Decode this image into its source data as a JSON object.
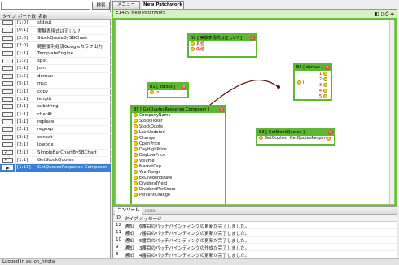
{
  "search": {
    "placeholder": "",
    "button_label": "検索"
  },
  "tabs": [
    {
      "label": "メニュー"
    },
    {
      "label": "New Patchwork"
    }
  ],
  "list": {
    "headers": [
      "タイプ",
      "ポート数",
      "名前"
    ],
    "rows": [
      {
        "ports": "[1:0]",
        "name": "stdout",
        "type": "normal"
      },
      {
        "ports": "[0:1]",
        "name": "実験表現式は正しい?",
        "type": "normal"
      },
      {
        "ports": "[2:0]",
        "name": "StockQuoteBySBChart",
        "type": "normal"
      },
      {
        "ports": "[2:0]",
        "name": "範囲便利経済Googleカラフ出力",
        "type": "normal"
      },
      {
        "ports": "[1:1]",
        "name": "TemplateEngine",
        "type": "normal"
      },
      {
        "ports": "[1:2]",
        "name": "split",
        "type": "normal"
      },
      {
        "ports": "[2:1]",
        "name": "join",
        "type": "normal"
      },
      {
        "ports": "[1:5]",
        "name": "demux",
        "type": "normal"
      },
      {
        "ports": "[5:1]",
        "name": "mux",
        "type": "normal"
      },
      {
        "ports": "[1:1]",
        "name": "copy",
        "type": "normal"
      },
      {
        "ports": "[1:1]",
        "name": "length",
        "type": "normal"
      },
      {
        "ports": "[3:1]",
        "name": "substring",
        "type": "normal"
      },
      {
        "ports": "[1:1]",
        "name": "charAt",
        "type": "normal"
      },
      {
        "ports": "[3:1]",
        "name": "replace",
        "type": "normal"
      },
      {
        "ports": "[2:1]",
        "name": "regexp",
        "type": "normal"
      },
      {
        "ports": "[2:1]",
        "name": "concat",
        "type": "normal"
      },
      {
        "ports": "[2:1]",
        "name": "lowbdx",
        "type": "normal"
      },
      {
        "ports": "[2:1]",
        "name": "SimpleBarChartBySBChart",
        "type": "check"
      },
      {
        "ports": "[1:1]",
        "name": "GetStockQuotes",
        "type": "check"
      },
      {
        "ports": "[1:13]",
        "name": "GetQuotesResponse Composer",
        "type": "run"
      }
    ]
  },
  "editor": {
    "title": "E1429 New Patchwork",
    "tools": "◧ ▯ ⎙ ◈"
  },
  "nodes": {
    "b2": {
      "title": "B2 [ 実験表現式は正しい? ]",
      "ports": [
        "真値",
        "偽値"
      ]
    },
    "b1": {
      "title": "B1 [ stdout ]",
      "ports": [
        "in"
      ]
    },
    "b4": {
      "title": "B4 [ demux ]",
      "in": "i",
      "ports": [
        "1",
        "2",
        "3",
        "4",
        "5"
      ]
    },
    "b3": {
      "title": "B3 [ GetStockQuotes ]",
      "in": "GetQuotes",
      "out": "GetQuotesResponse"
    },
    "b5": {
      "title": "B5 [ GetQuotesResponse Composer ]",
      "ports": [
        "CompanyName",
        "StockTicker",
        "StockQuote",
        "LastUpdated",
        "Change",
        "OpenPrice",
        "DayHighPrice",
        "DayLowPrice",
        "Volume",
        "MarketCap",
        "YearRange",
        "ExDividendDate",
        "DividendYield",
        "DividendPerShare",
        "PercentChange"
      ]
    }
  },
  "console": {
    "tabs": [
      "コンソール",
      "MEMO"
    ],
    "headers": [
      "ID",
      "タイプ",
      "メッセージ"
    ],
    "rows": [
      {
        "id": "12",
        "type": "通知",
        "msg": "6番目のパッチバインディングの更新が完了しました。"
      },
      {
        "id": "11",
        "type": "通知",
        "msg": "7番目のパッチバインディングの更新が完了しました。"
      },
      {
        "id": "10",
        "type": "通知",
        "msg": "5番目のパッチバインディングの更新が完了しました。"
      },
      {
        "id": "9",
        "type": "通知",
        "msg": "3番目のパッチバインディングの作成が完了しました。"
      },
      {
        "id": "8",
        "type": "通知",
        "msg": "4番目のパッチバインディングの更新が完了しました。"
      }
    ]
  },
  "status": "Logged in as: oh_hirota"
}
